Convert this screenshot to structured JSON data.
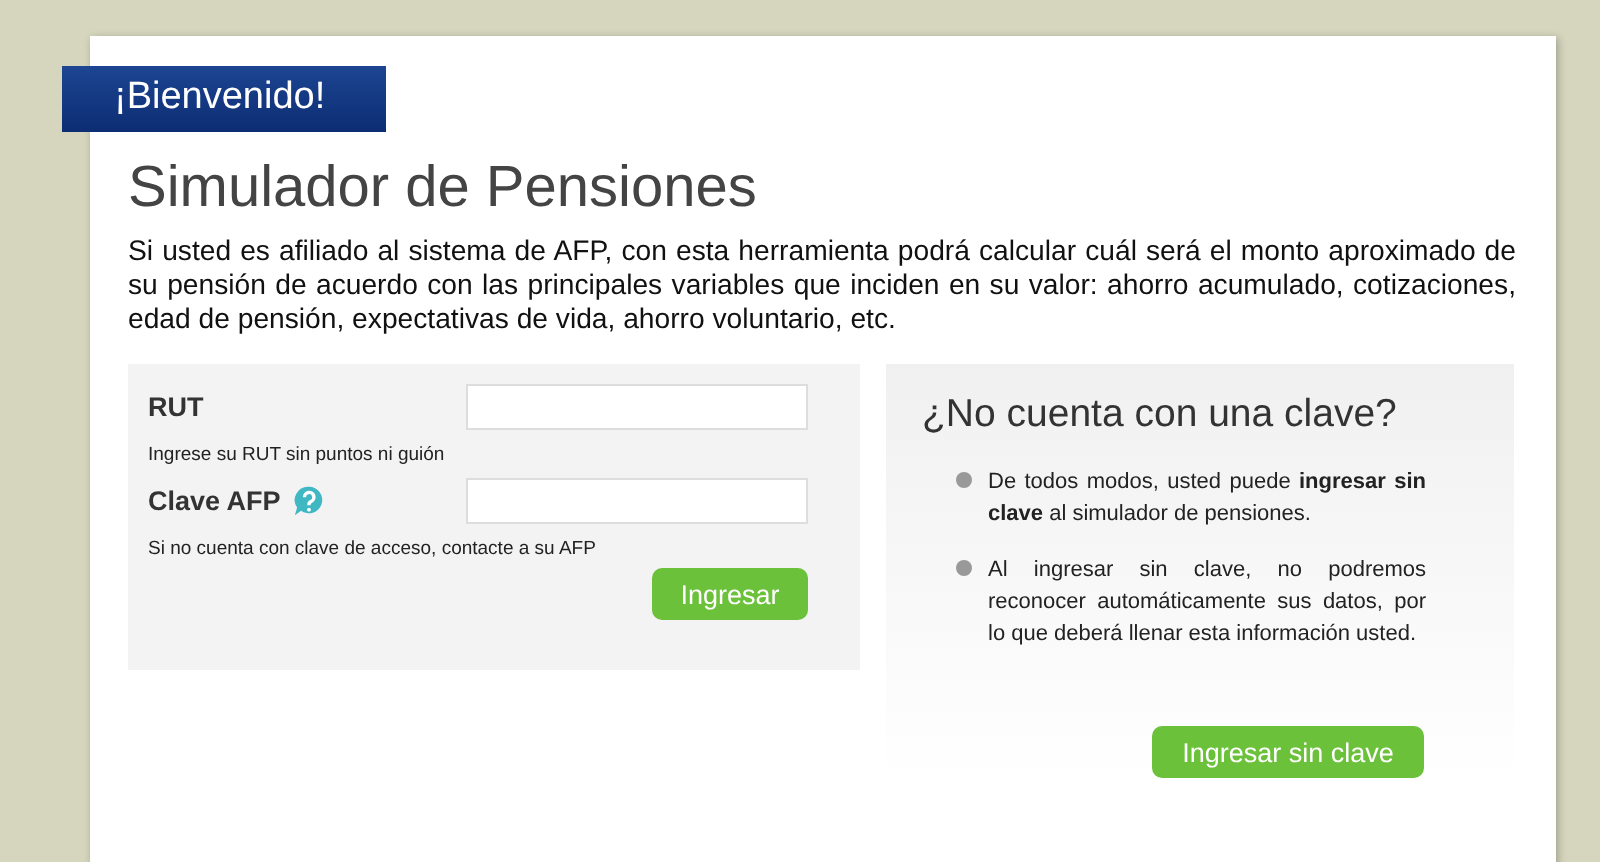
{
  "banner": {
    "text": "¡Bienvenido!"
  },
  "title": "Simulador de Pensiones",
  "intro": "Si usted es afiliado al sistema de AFP, con esta herramienta podrá calcular cuál será el monto aproximado de su pensión de acuerdo con las principales variables que inciden en su valor: ahorro acumulado, cotizaciones, edad de pensión, expectativas de vida, ahorro voluntario, etc.",
  "login": {
    "fields": [
      {
        "label": "RUT",
        "help_icon": false,
        "hint": "Ingrese su RUT sin puntos ni guión"
      },
      {
        "label": "Clave AFP",
        "help_icon": true,
        "hint": "Si no cuenta con clave de acceso, contacte a su AFP"
      }
    ],
    "button": "Ingresar"
  },
  "no_key": {
    "title": "¿No cuenta con una clave?",
    "bullets": [
      "De todos modos, usted puede **ingresar sin clave** al simulador de pensiones.",
      "Al ingresar sin clave, no podremos reconocer automáticamente sus datos, por lo que deberá llenar esta información usted."
    ],
    "button": "Ingresar sin clave"
  }
}
